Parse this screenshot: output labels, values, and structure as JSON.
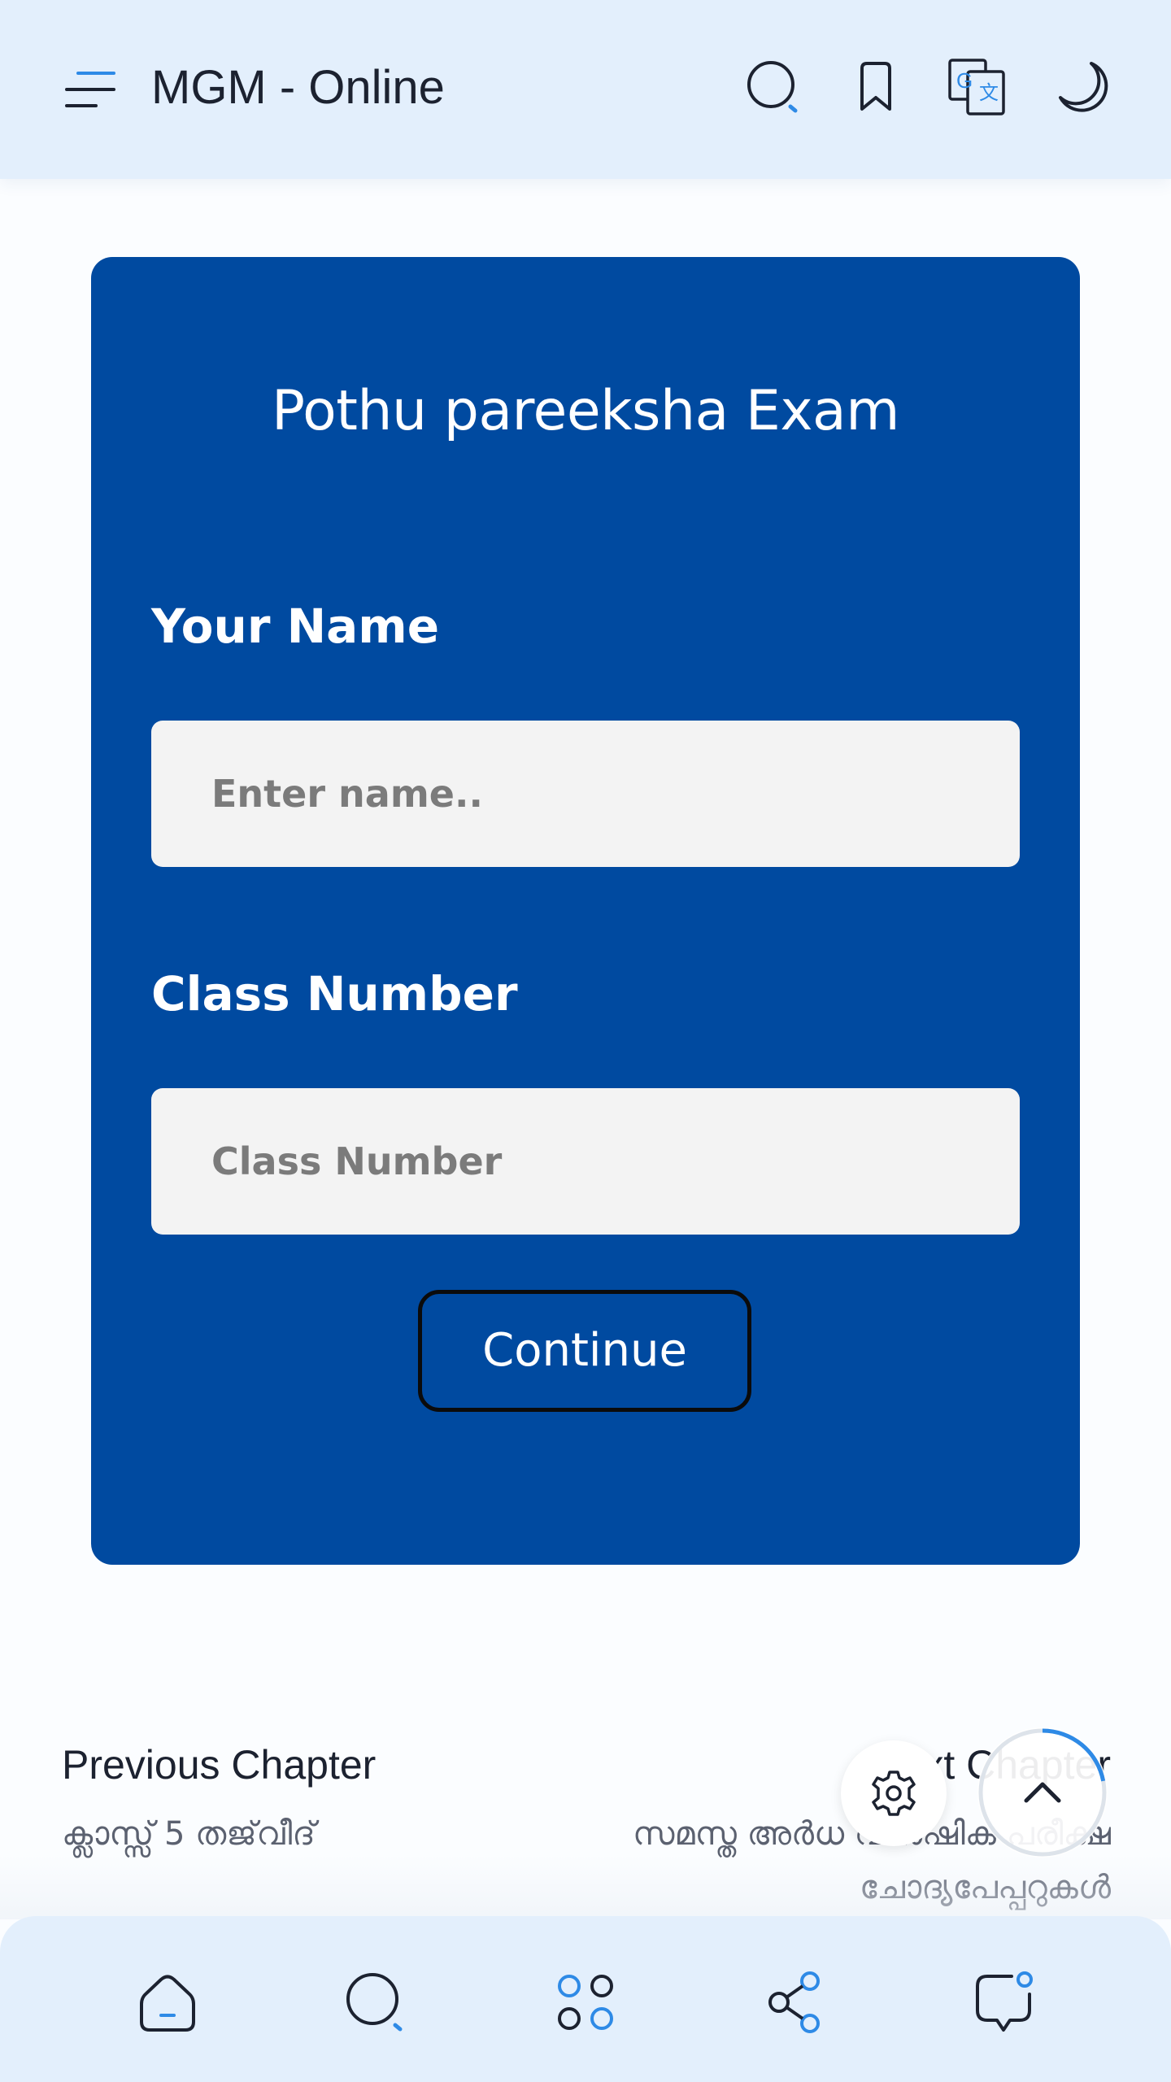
{
  "header": {
    "title": "MGM - Online",
    "icons": [
      "menu-icon",
      "search-icon",
      "bookmark-icon",
      "translate-icon",
      "moon-icon"
    ]
  },
  "form": {
    "title": "Pothu pareeksha Exam",
    "name_label": "Your Name",
    "name_placeholder": "Enter name..",
    "class_label": "Class Number",
    "class_placeholder": "Class Number",
    "continue_label": "Continue"
  },
  "chapters": {
    "previous_heading": "Previous Chapter",
    "previous_title": "ക്ലാസ്സ് 5 തജ്‌വീദ്",
    "next_heading": "Next Chapter",
    "next_title": "സമസ്ത അർധ വാർഷിക പരീക്ഷ ചോദ്യപേപ്പറുകൾ"
  },
  "floating": {
    "icons": [
      "settings-icon",
      "arrow-up-icon"
    ],
    "scroll_progress": 0.22
  },
  "bottom_nav": {
    "icons": [
      "home-icon",
      "search-icon",
      "apps-icon",
      "share-icon",
      "chat-icon"
    ]
  },
  "colors": {
    "accent": "#2e8ae6",
    "card": "#004aa0",
    "bar": "#e3effc",
    "text": "#1c2230"
  }
}
